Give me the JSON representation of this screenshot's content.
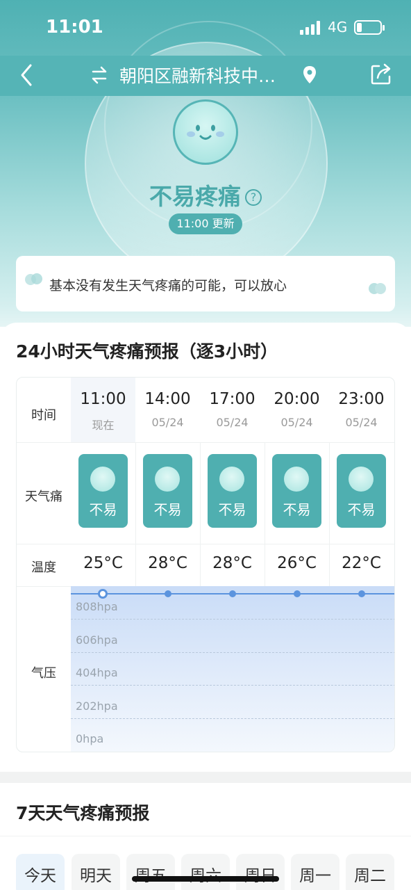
{
  "status_bar": {
    "time": "11:01",
    "network": "4G"
  },
  "nav": {
    "title": "朝阳区融新科技中…"
  },
  "hero": {
    "status": "不易疼痛",
    "help_icon_text": "?",
    "update_badge": "11:00 更新",
    "tip": "基本没有发生天气疼痛的可能，可以放心"
  },
  "forecast24": {
    "title": "24小时天气疼痛预报（逐3小时）",
    "row_labels": {
      "time": "时间",
      "pain": "天气痛",
      "temp": "温度",
      "pressure": "气压"
    },
    "columns": [
      {
        "time": "11:00",
        "date": "现在",
        "pain": "不易",
        "temp": "25°C"
      },
      {
        "time": "14:00",
        "date": "05/24",
        "pain": "不易",
        "temp": "28°C"
      },
      {
        "time": "17:00",
        "date": "05/24",
        "pain": "不易",
        "temp": "28°C"
      },
      {
        "time": "20:00",
        "date": "05/24",
        "pain": "不易",
        "temp": "26°C"
      },
      {
        "time": "23:00",
        "date": "05/24",
        "pain": "不易",
        "temp": "22°C"
      }
    ],
    "pressure_axis": [
      "808hpa",
      "606hpa",
      "404hpa",
      "202hpa",
      "0hpa"
    ]
  },
  "forecast7": {
    "title": "7天天气疼痛预报",
    "tabs": [
      "今天",
      "明天",
      "周五",
      "周六",
      "周日",
      "周一",
      "周二"
    ]
  },
  "colors": {
    "teal": "#4fafb0",
    "pressure_line": "#5b94de"
  }
}
